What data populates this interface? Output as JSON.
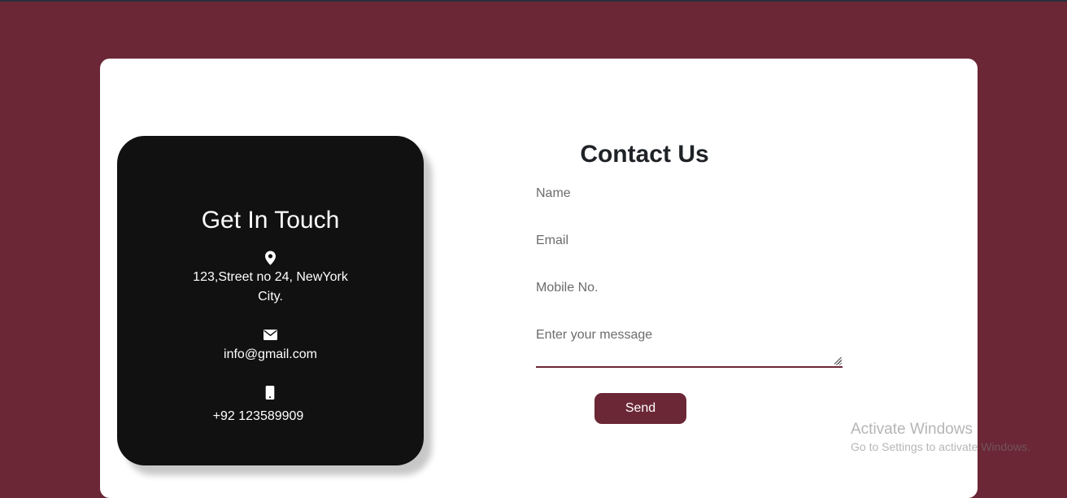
{
  "colors": {
    "page_background": "#6b2735",
    "card_background": "#ffffff",
    "panel_background": "#111111",
    "accent": "#6b2735",
    "title_text": "#1f2226"
  },
  "info": {
    "title": "Get In Touch",
    "address_icon": "map-pin-icon",
    "address_line1": "123,Street no 24, NewYork",
    "address_line2": "City.",
    "email_icon": "envelope-icon",
    "email": "info@gmail.com",
    "phone_icon": "mobile-phone-icon",
    "phone": "+92 123589909"
  },
  "form": {
    "title": "Contact Us",
    "name_placeholder": "Name",
    "email_placeholder": "Email",
    "mobile_placeholder": "Mobile No.",
    "message_placeholder": "Enter your message",
    "send_label": "Send"
  },
  "watermark": {
    "title": "Activate Windows",
    "subtitle": "Go to Settings to activate Windows."
  }
}
